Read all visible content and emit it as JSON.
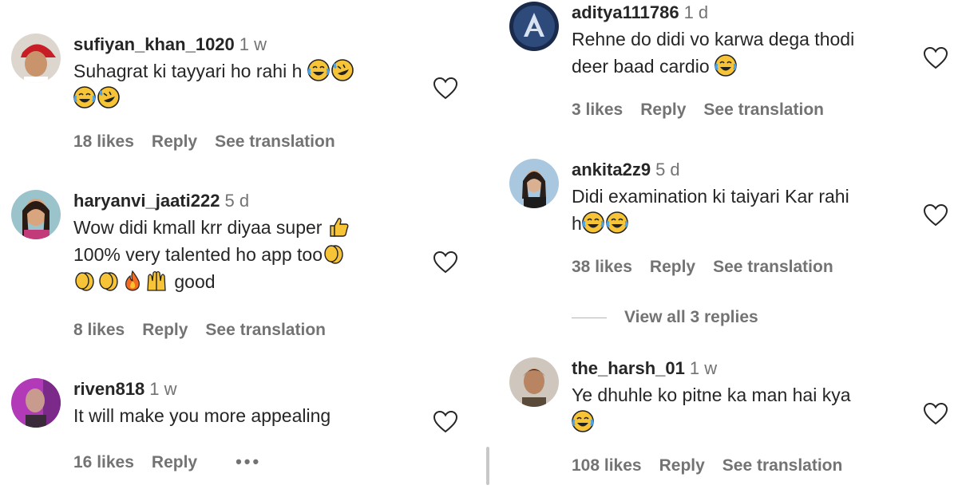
{
  "left": {
    "comments": [
      {
        "username": "sufiyan_khan_1020",
        "time": "1 w",
        "text_line1": "Suhagrat ki tayyari ho rahi h",
        "likes": "18 likes",
        "reply": "Reply",
        "translate": "See translation"
      },
      {
        "username": "haryanvi_jaati222",
        "time": "5 d",
        "text_line1": "Wow didi kmall krr diyaa super",
        "text_line2": "100% very talented ho app too",
        "text_line3": "good",
        "likes": "8 likes",
        "reply": "Reply",
        "translate": "See translation"
      },
      {
        "username": "riven818",
        "time": "1 w",
        "text_line1": "It will make you more appealing",
        "likes": "16 likes",
        "reply": "Reply",
        "more": "•••"
      }
    ]
  },
  "right": {
    "comments": [
      {
        "username": "aditya111786",
        "time": "1 d",
        "text_line1": "Rehne do didi vo karwa dega thodi",
        "text_line2": "deer baad cardio",
        "likes": "3 likes",
        "reply": "Reply",
        "translate": "See translation"
      },
      {
        "username": "ankita2z9",
        "time": "5 d",
        "text_line1": "Didi examination ki taiyari Kar rahi",
        "text_line2": "h",
        "likes": "38 likes",
        "reply": "Reply",
        "translate": "See translation",
        "view_replies": "View all 3 replies"
      },
      {
        "username": "the_harsh_01",
        "time": "1 w",
        "text_line1": "Ye dhuhle ko pitne ka man hai kya",
        "likes": "108 likes",
        "reply": "Reply",
        "translate": "See translation"
      }
    ]
  },
  "icons": {
    "like": "heart-outline-icon",
    "laugh": "face-with-tears-of-joy-emoji",
    "rofl": "rolling-on-floor-laughing-emoji",
    "thumbs": "thumbs-up-emoji",
    "clap": "clapping-hands-emoji",
    "fire": "fire-emoji",
    "raised": "raising-hands-emoji"
  },
  "colors": {
    "text": "#262626",
    "muted": "#737373",
    "emoji": "#f7c437"
  }
}
